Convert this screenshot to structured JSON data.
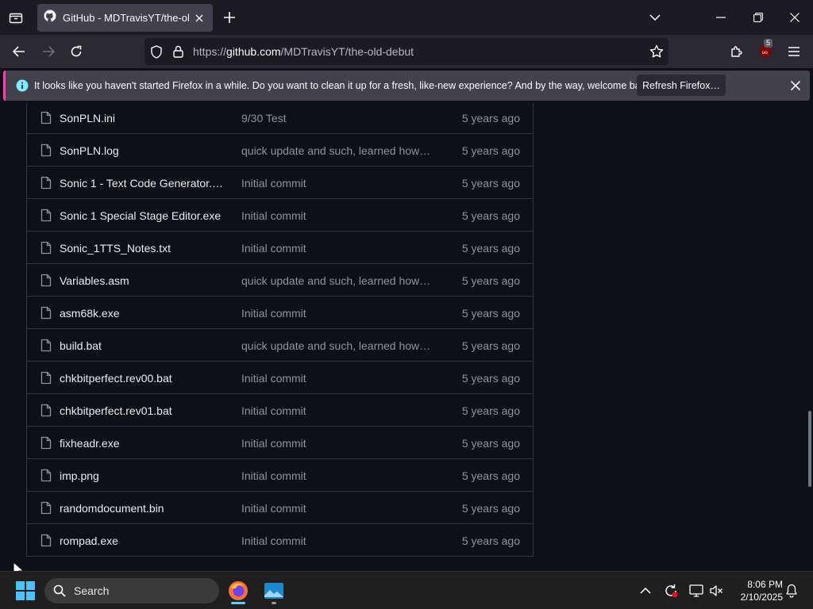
{
  "browser": {
    "tab_title": "GitHub - MDTravisYT/the-old-debut",
    "url_prefix": "https://",
    "url_domain": "github.com",
    "url_path": "/MDTravisYT/the-old-debut",
    "extension_badge": "5"
  },
  "notification": {
    "message": "It looks like you haven't started Firefox in a while. Do you want to clean it up for a fresh, like-new experience? And by the way, welcome back!",
    "button_label": "Refresh Firefox…"
  },
  "files": [
    {
      "name": "SonPLN.ini",
      "message": "9/30 Test",
      "age": "5 years ago"
    },
    {
      "name": "SonPLN.log",
      "message": "quick update and such, learned how…",
      "age": "5 years ago"
    },
    {
      "name": "Sonic 1 - Text Code Generator.…",
      "message": "Initial commit",
      "age": "5 years ago"
    },
    {
      "name": "Sonic 1 Special Stage Editor.exe",
      "message": "Initial commit",
      "age": "5 years ago"
    },
    {
      "name": "Sonic_1TTS_Notes.txt",
      "message": "Initial commit",
      "age": "5 years ago"
    },
    {
      "name": "Variables.asm",
      "message": "quick update and such, learned how…",
      "age": "5 years ago"
    },
    {
      "name": "asm68k.exe",
      "message": "Initial commit",
      "age": "5 years ago"
    },
    {
      "name": "build.bat",
      "message": "quick update and such, learned how…",
      "age": "5 years ago"
    },
    {
      "name": "chkbitperfect.rev00.bat",
      "message": "Initial commit",
      "age": "5 years ago"
    },
    {
      "name": "chkbitperfect.rev01.bat",
      "message": "Initial commit",
      "age": "5 years ago"
    },
    {
      "name": "fixheadr.exe",
      "message": "Initial commit",
      "age": "5 years ago"
    },
    {
      "name": "imp.png",
      "message": "Initial commit",
      "age": "5 years ago"
    },
    {
      "name": "randomdocument.bin",
      "message": "Initial commit",
      "age": "5 years ago"
    },
    {
      "name": "rompad.exe",
      "message": "Initial commit",
      "age": "5 years ago"
    }
  ],
  "taskbar": {
    "search_label": "Search",
    "time": "8:06 PM",
    "date": "2/10/2025"
  },
  "colors": {
    "accent_pink": "#e24bb5",
    "info_blue": "#80ebff",
    "firefox_orange": "#ff7139"
  }
}
